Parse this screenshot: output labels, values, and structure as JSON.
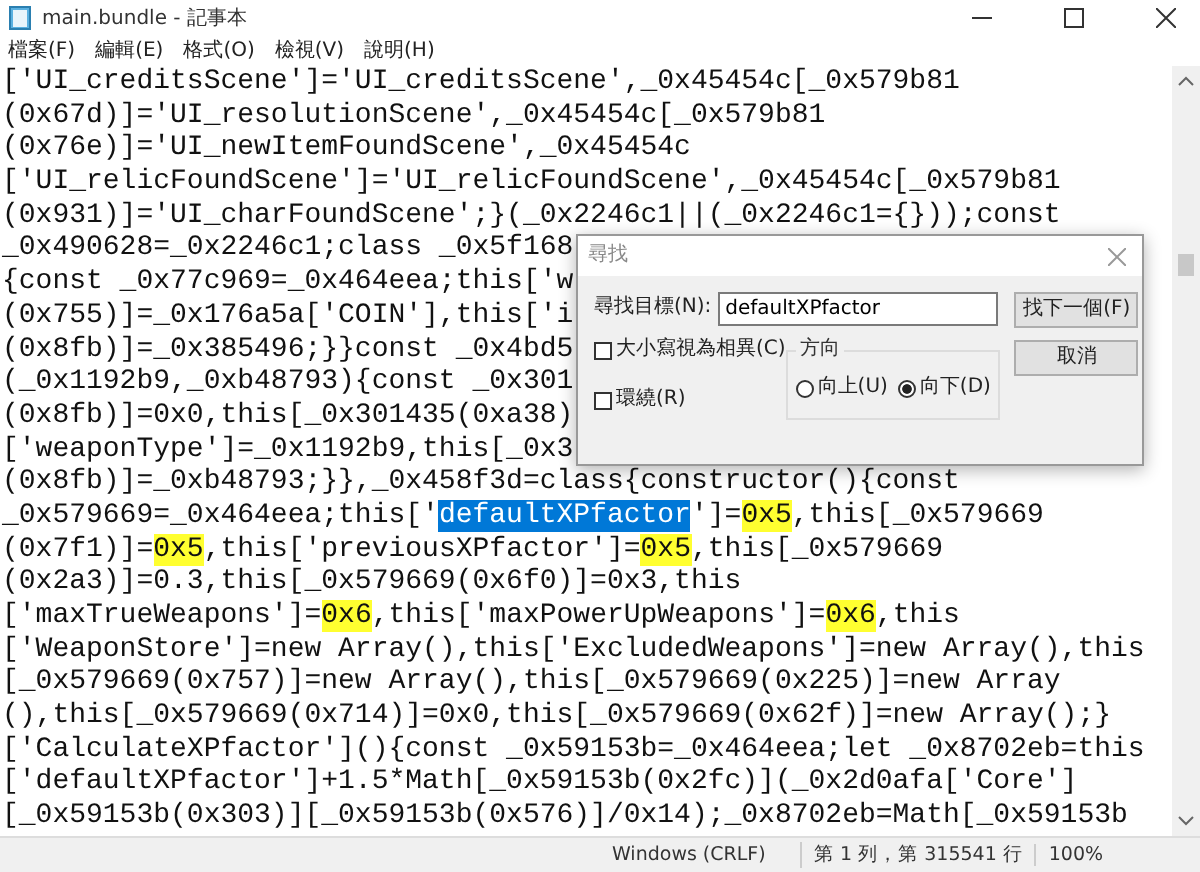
{
  "window": {
    "title": "main.bundle - 記事本"
  },
  "menu": [
    "檔案(F)",
    "編輯(E)",
    "格式(O)",
    "檢視(V)",
    "說明(H)"
  ],
  "lines": [
    {
      "segments": [
        {
          "kind": "plain",
          "text": "['UI_creditsScene']='UI_creditsScene',_0x45454c[_0x579b81"
        }
      ]
    },
    {
      "segments": [
        {
          "kind": "plain",
          "text": "(0x67d)]='UI_resolutionScene',_0x45454c[_0x579b81"
        }
      ]
    },
    {
      "segments": [
        {
          "kind": "plain",
          "text": "(0x76e)]='UI_newItemFoundScene',_0x45454c"
        }
      ]
    },
    {
      "segments": [
        {
          "kind": "plain",
          "text": "['UI_relicFoundScene']='UI_relicFoundScene',_0x45454c[_0x579b81"
        }
      ]
    },
    {
      "segments": [
        {
          "kind": "plain",
          "text": "(0x931)]='UI_charFoundScene';}(_0x2246c1||(_0x2246c1={}));const"
        }
      ]
    },
    {
      "segments": [
        {
          "kind": "plain",
          "text": "_0x490628=_0x2246c1;class _0x5f168"
        }
      ]
    },
    {
      "segments": [
        {
          "kind": "plain",
          "text": "{const _0x77c969=_0x464eea;this['w"
        }
      ]
    },
    {
      "segments": [
        {
          "kind": "plain",
          "text": "(0x755)]=_0x176a5a['COIN'],this['i"
        }
      ]
    },
    {
      "segments": [
        {
          "kind": "plain",
          "text": "(0x8fb)]=_0x385496;}}const _0x4bd5"
        }
      ]
    },
    {
      "segments": [
        {
          "kind": "plain",
          "text": "(_0x1192b9,_0xb48793){const _0x301"
        }
      ]
    },
    {
      "segments": [
        {
          "kind": "plain",
          "text": "(0x8fb)]=0x0,this[_0x301435(0xa38)"
        }
      ]
    },
    {
      "segments": [
        {
          "kind": "plain",
          "text": "['weaponType']=_0x1192b9,this[_0x3"
        }
      ]
    },
    {
      "segments": [
        {
          "kind": "plain",
          "text": "(0x8fb)]=_0xb48793;}},_0x458f3d=class{constructor(){const"
        }
      ]
    },
    {
      "segments": [
        {
          "kind": "plain",
          "text": "_0x579669=_0x464eea;this['"
        },
        {
          "kind": "selection",
          "text": "defaultXPfactor"
        },
        {
          "kind": "plain",
          "text": "']="
        },
        {
          "kind": "match",
          "text": "0x5"
        },
        {
          "kind": "plain",
          "text": ",this[_0x579669"
        }
      ]
    },
    {
      "segments": [
        {
          "kind": "plain",
          "text": "(0x7f1)]="
        },
        {
          "kind": "match",
          "text": "0x5"
        },
        {
          "kind": "plain",
          "text": ",this['previousXPfactor']="
        },
        {
          "kind": "match",
          "text": "0x5"
        },
        {
          "kind": "plain",
          "text": ",this[_0x579669"
        }
      ]
    },
    {
      "segments": [
        {
          "kind": "plain",
          "text": "(0x2a3)]=0.3,this[_0x579669(0x6f0)]=0x3,this"
        }
      ]
    },
    {
      "segments": [
        {
          "kind": "plain",
          "text": "['maxTrueWeapons']="
        },
        {
          "kind": "match",
          "text": "0x6"
        },
        {
          "kind": "plain",
          "text": ",this['maxPowerUpWeapons']="
        },
        {
          "kind": "match",
          "text": "0x6"
        },
        {
          "kind": "plain",
          "text": ",this"
        }
      ]
    },
    {
      "segments": [
        {
          "kind": "plain",
          "text": "['WeaponStore']=new Array(),this['ExcludedWeapons']=new Array(),this"
        }
      ]
    },
    {
      "segments": [
        {
          "kind": "plain",
          "text": "[_0x579669(0x757)]=new Array(),this[_0x579669(0x225)]=new Array"
        }
      ]
    },
    {
      "segments": [
        {
          "kind": "plain",
          "text": "(),this[_0x579669(0x714)]=0x0,this[_0x579669(0x62f)]=new Array();}"
        }
      ]
    },
    {
      "segments": [
        {
          "kind": "plain",
          "text": "['CalculateXPfactor'](){const _0x59153b=_0x464eea;let _0x8702eb=this"
        }
      ]
    },
    {
      "segments": [
        {
          "kind": "plain",
          "text": "['defaultXPfactor']+1.5*Math[_0x59153b(0x2fc)](_0x2d0afa['Core']"
        }
      ]
    },
    {
      "segments": [
        {
          "kind": "plain",
          "text": "[_0x59153b(0x303)][_0x59153b(0x576)]/0x14);_0x8702eb=Math[_0x59153b"
        }
      ]
    }
  ],
  "find_dialog": {
    "title": "尋找",
    "find_label": "尋找目標(N):",
    "find_value": "defaultXPfactor",
    "buttons": [
      "找下一個(F)",
      "取消"
    ],
    "direction": {
      "label": "方向",
      "options": [
        {
          "label": "向上(U)",
          "selected": false
        },
        {
          "label": "向下(D)",
          "selected": true
        }
      ]
    },
    "options": [
      {
        "label": "大小寫視為相異(C)",
        "checked": false
      },
      {
        "label": "環繞(R)",
        "checked": false
      }
    ]
  },
  "status_bar": [
    "Windows (CRLF)",
    "第 1 列，第 315541 行",
    "100%"
  ]
}
